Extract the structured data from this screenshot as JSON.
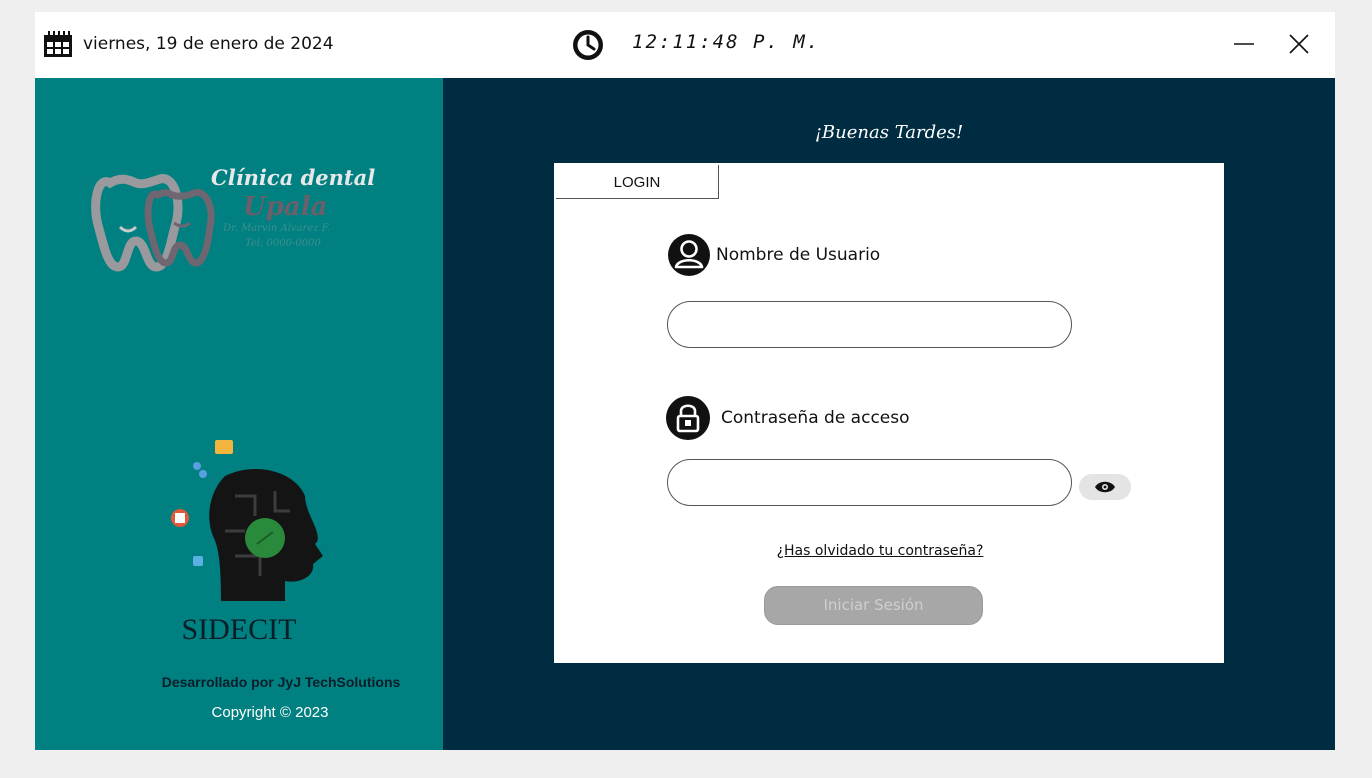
{
  "titlebar": {
    "date": "viernes, 19 de enero de 2024",
    "time": "12:11:48 P. M.",
    "calendar_icon": "calendar-icon",
    "clock_icon": "clock-icon",
    "minimize_icon": "minimize-icon",
    "close_icon": "close-icon"
  },
  "sidebar": {
    "logo": {
      "line1": "Clínica dental",
      "line2": "Upala",
      "line3": "Dr. Marvin Alvarez F.",
      "line4": "Tel: 0000-0000"
    },
    "product_name": "SIDECIT",
    "developer": "Desarrollado por JyJ TechSolutions",
    "copyright": "Copyright © 2023"
  },
  "main": {
    "greeting": "¡Buenas Tardes!",
    "login": {
      "tab_label": "LOGIN",
      "username_label": "Nombre de Usuario",
      "username_value": "",
      "password_label": "Contraseña de acceso",
      "password_value": "",
      "show_password_icon": "eye-icon",
      "forgot_link": "¿Has olvidado tu contraseña?",
      "submit_label": "Iniciar Sesión"
    }
  },
  "colors": {
    "sidebar_bg": "#008080",
    "main_bg": "#002c42",
    "button_disabled": "#a7a7a7"
  }
}
